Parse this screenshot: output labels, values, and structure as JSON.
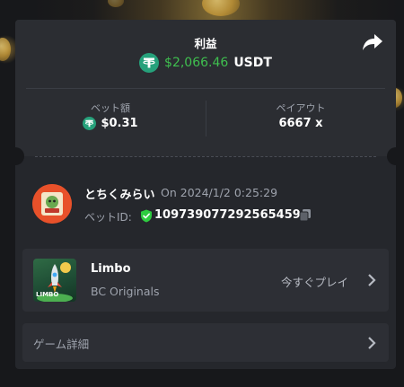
{
  "header": {
    "title": "利益",
    "profit_amount": "$2,066.46",
    "currency": "USDT"
  },
  "stats": {
    "bet_amount_label": "ベット額",
    "bet_amount_value": "$0.31",
    "payout_label": "ペイアウト",
    "payout_value": "6667 x"
  },
  "bet": {
    "username": "とちくみらい",
    "datetime": "On 2024/1/2 0:25:29",
    "bet_id_label": "ベットID:",
    "bet_id_value": "109739077292565459"
  },
  "game": {
    "name": "Limbo",
    "provider": "BC Originals",
    "play_now_label": "今すぐプレイ",
    "thumb_label": "LIMBO"
  },
  "details": {
    "label": "ゲーム詳細"
  },
  "colors": {
    "profit_green": "#3fbf4f",
    "usdt_teal": "#26a17b",
    "verified_green": "#2ecc40",
    "card_bg": "#25272c",
    "page_bg": "#17181b"
  }
}
